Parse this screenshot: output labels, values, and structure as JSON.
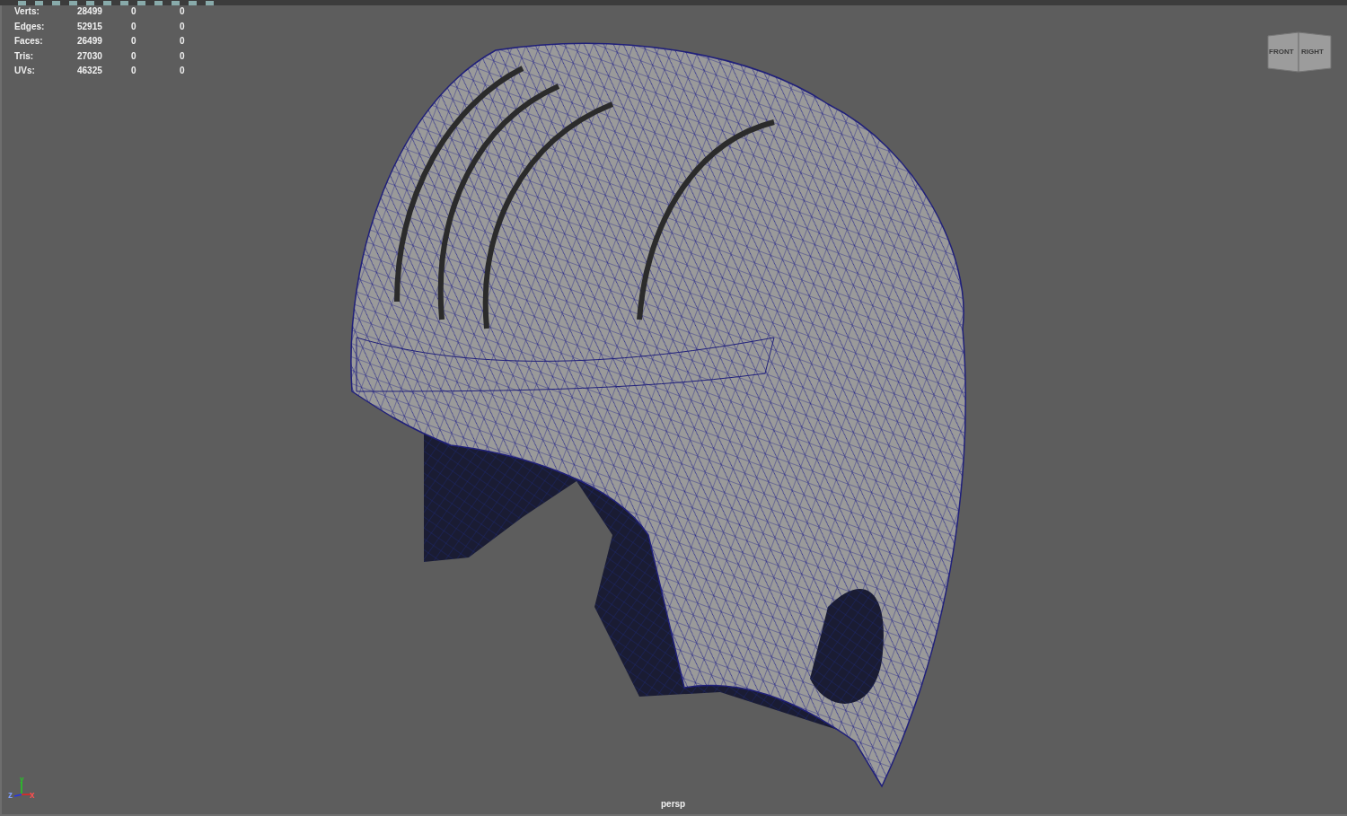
{
  "heads_up_display": {
    "rows": [
      {
        "label": "Verts:",
        "values": [
          "28499",
          "0",
          "0"
        ]
      },
      {
        "label": "Edges:",
        "values": [
          "52915",
          "0",
          "0"
        ]
      },
      {
        "label": "Faces:",
        "values": [
          "26499",
          "0",
          "0"
        ]
      },
      {
        "label": "Tris:",
        "values": [
          "27030",
          "0",
          "0"
        ]
      },
      {
        "label": "UVs:",
        "values": [
          "46325",
          "0",
          "0"
        ]
      }
    ]
  },
  "view_cube": {
    "faces": [
      "FRONT",
      "RIGHT"
    ]
  },
  "axis_indicator": {
    "x": "x",
    "y": "y",
    "z": "z"
  },
  "camera_label": "persp"
}
